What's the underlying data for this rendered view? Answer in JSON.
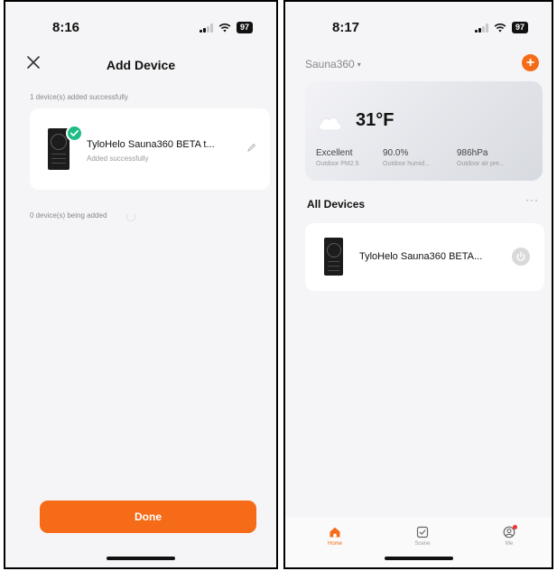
{
  "left": {
    "status": {
      "time": "8:16",
      "battery": "97"
    },
    "title": "Add Device",
    "added_label": "1 device(s) added successfully",
    "device": {
      "name": "TyloHelo Sauna360 BETA t...",
      "status": "Added successfully"
    },
    "adding_label": "0 device(s) being added",
    "done_label": "Done"
  },
  "right": {
    "status": {
      "time": "8:17",
      "battery": "97"
    },
    "home_name": "Sauna360",
    "weather": {
      "temp": "31°F",
      "metrics": [
        {
          "value": "Excellent",
          "label": "Outdoor PM2.5"
        },
        {
          "value": "90.0%",
          "label": "Outdoor humid..."
        },
        {
          "value": "986hPa",
          "label": "Outdoor air pre..."
        }
      ]
    },
    "devices_heading": "All Devices",
    "more": "···",
    "device": {
      "name": "TyloHelo Sauna360 BETA..."
    },
    "tabs": [
      {
        "label": "Home",
        "icon": "home-icon",
        "active": true
      },
      {
        "label": "Scene",
        "icon": "scene-icon",
        "active": false
      },
      {
        "label": "Me",
        "icon": "profile-icon",
        "active": false
      }
    ]
  },
  "colors": {
    "accent": "#f56b17",
    "success": "#1dbd84",
    "badge": "#f0352f"
  }
}
